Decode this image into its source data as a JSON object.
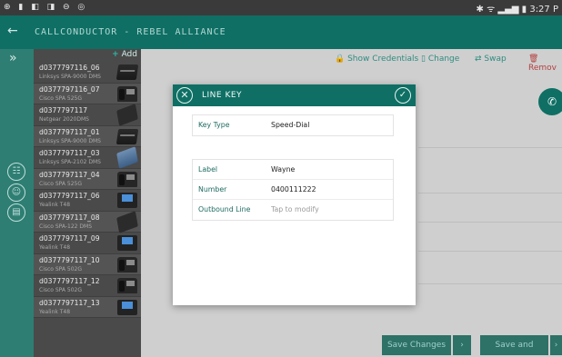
{
  "statusbar": {
    "left_icons": "⊕ ▮ ◧ ◨ ⊖ ◎",
    "right": "✱ ᯤ ▂▄▆ ▮ 3:27 P"
  },
  "appbar": {
    "back_icon": "arrow-left-icon",
    "title": "CALLCONDUCTOR - REBEL ALLIANCE"
  },
  "rail": {
    "expand_icon": "double-chevron-right-icon",
    "icons": [
      "contacts-icon",
      "user-icon",
      "phone-icon"
    ]
  },
  "device_list": {
    "add_label": "Add",
    "items": [
      {
        "name": "d0377797116_06",
        "model": "Linksys SPA-9000 DMS",
        "kind": "box"
      },
      {
        "name": "d0377797116_07",
        "model": "Cisco SPA 525G",
        "kind": "desk"
      },
      {
        "name": "d0377797117",
        "model": "Netgear 2020DMS",
        "kind": "ata"
      },
      {
        "name": "d0377797117_01",
        "model": "Linksys SPA-9000 DMS",
        "kind": "box"
      },
      {
        "name": "d0377797117_03",
        "model": "Linksys SPA-2102 DMS",
        "kind": "ata-blue"
      },
      {
        "name": "d0377797117_04",
        "model": "Cisco SPA 525G",
        "kind": "desk"
      },
      {
        "name": "d0377797117_06",
        "model": "Yealink T48",
        "kind": "blue"
      },
      {
        "name": "d0377797117_08",
        "model": "Cisco SPA-122 DMS",
        "kind": "ata"
      },
      {
        "name": "d0377797117_09",
        "model": "Yealink T48",
        "kind": "blue"
      },
      {
        "name": "d0377797117_10",
        "model": "Cisco SPA 502G",
        "kind": "desk"
      },
      {
        "name": "d0377797117_12",
        "model": "Cisco SPA 502G",
        "kind": "desk"
      },
      {
        "name": "d0377797117_13",
        "model": "Yealink T48",
        "kind": "blue"
      }
    ]
  },
  "toolbar": {
    "show_credentials": "Show Credentials",
    "change": "Change",
    "swap": "Swap",
    "remove": "Remov"
  },
  "footer": {
    "save_changes": "Save Changes",
    "save_restart": "Save and Restart"
  },
  "modal": {
    "title": "LINE KEY",
    "key_type_label": "Key Type",
    "key_type_value": "Speed-Dial",
    "label_label": "Label",
    "label_value": "Wayne",
    "number_label": "Number",
    "number_value": "0400111222",
    "outbound_label": "Outbound Line",
    "outbound_value": "Tap to modify"
  },
  "colors": {
    "primary": "#0f6f64",
    "accent": "#29b9a8",
    "danger": "#b44040"
  }
}
